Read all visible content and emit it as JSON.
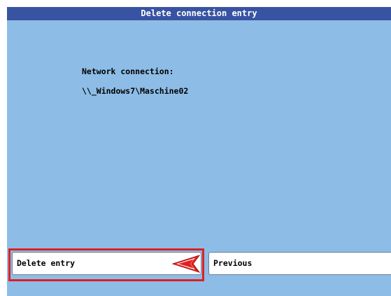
{
  "window": {
    "title": "Delete connection entry"
  },
  "content": {
    "label": "Network connection:",
    "value": "\\\\_Windows7\\Maschine02"
  },
  "softkeys": {
    "delete_label": "Delete entry",
    "previous_label": "Previous"
  },
  "colors": {
    "background": "#8dbde6",
    "title_bar": "#3853a1",
    "highlight": "#e02020"
  },
  "icons": {
    "pointer": "red-arrow-pointer-icon"
  }
}
